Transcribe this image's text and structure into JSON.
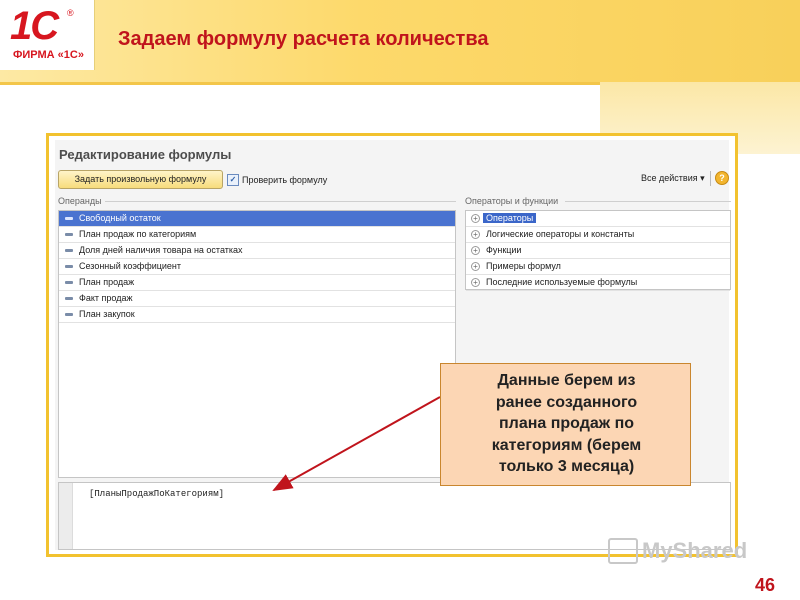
{
  "slide": {
    "logo_mark": "1С",
    "logo_reg": "®",
    "logo_sub": "ФИРМА «1С»",
    "title": "Задаем формулу расчета количества",
    "number": "46"
  },
  "form": {
    "title": "Редактирование формулы",
    "toolbar": {
      "custom_formula_button": "Задать произвольную формулу",
      "check_formula_button": "Проверить формулу",
      "all_actions": "Все действия",
      "help": "?"
    },
    "operands": {
      "label": "Операнды",
      "items": [
        "Свободный остаток",
        "План продаж по категориям",
        "Доля дней наличия товара на остатках",
        "Сезонный коэффициент",
        "План продаж",
        "Факт продаж",
        "План закупок"
      ]
    },
    "operators": {
      "label": "Операторы и функции",
      "items": [
        "Операторы",
        "Логические операторы и константы",
        "Функции",
        "Примеры формул",
        "Последние используемые формулы"
      ]
    },
    "editor": {
      "value": "[ПланыПродажПоКатегориям]"
    }
  },
  "callout": {
    "lines": [
      "Данные берем из",
      "ранее созданного",
      "плана продаж по",
      "категориям (берем",
      "только 3 месяца)"
    ]
  },
  "watermark": "MyShared",
  "colors": {
    "brand_red": "#c0141c",
    "frame_yellow": "#f2c22f",
    "selection_blue": "#4a73d0",
    "callout_fill": "#fcd6b4",
    "arrow": "#c0141c"
  }
}
